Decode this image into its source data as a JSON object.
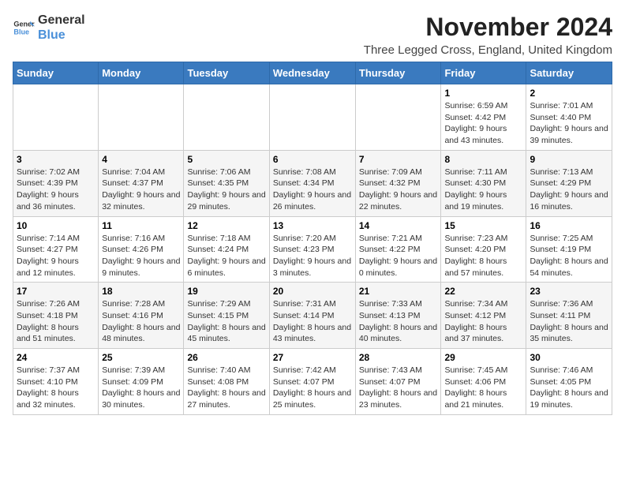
{
  "logo": {
    "line1": "General",
    "line2": "Blue"
  },
  "title": "November 2024",
  "subtitle": "Three Legged Cross, England, United Kingdom",
  "headers": [
    "Sunday",
    "Monday",
    "Tuesday",
    "Wednesday",
    "Thursday",
    "Friday",
    "Saturday"
  ],
  "weeks": [
    [
      {
        "day": "",
        "info": ""
      },
      {
        "day": "",
        "info": ""
      },
      {
        "day": "",
        "info": ""
      },
      {
        "day": "",
        "info": ""
      },
      {
        "day": "",
        "info": ""
      },
      {
        "day": "1",
        "info": "Sunrise: 6:59 AM\nSunset: 4:42 PM\nDaylight: 9 hours and 43 minutes."
      },
      {
        "day": "2",
        "info": "Sunrise: 7:01 AM\nSunset: 4:40 PM\nDaylight: 9 hours and 39 minutes."
      }
    ],
    [
      {
        "day": "3",
        "info": "Sunrise: 7:02 AM\nSunset: 4:39 PM\nDaylight: 9 hours and 36 minutes."
      },
      {
        "day": "4",
        "info": "Sunrise: 7:04 AM\nSunset: 4:37 PM\nDaylight: 9 hours and 32 minutes."
      },
      {
        "day": "5",
        "info": "Sunrise: 7:06 AM\nSunset: 4:35 PM\nDaylight: 9 hours and 29 minutes."
      },
      {
        "day": "6",
        "info": "Sunrise: 7:08 AM\nSunset: 4:34 PM\nDaylight: 9 hours and 26 minutes."
      },
      {
        "day": "7",
        "info": "Sunrise: 7:09 AM\nSunset: 4:32 PM\nDaylight: 9 hours and 22 minutes."
      },
      {
        "day": "8",
        "info": "Sunrise: 7:11 AM\nSunset: 4:30 PM\nDaylight: 9 hours and 19 minutes."
      },
      {
        "day": "9",
        "info": "Sunrise: 7:13 AM\nSunset: 4:29 PM\nDaylight: 9 hours and 16 minutes."
      }
    ],
    [
      {
        "day": "10",
        "info": "Sunrise: 7:14 AM\nSunset: 4:27 PM\nDaylight: 9 hours and 12 minutes."
      },
      {
        "day": "11",
        "info": "Sunrise: 7:16 AM\nSunset: 4:26 PM\nDaylight: 9 hours and 9 minutes."
      },
      {
        "day": "12",
        "info": "Sunrise: 7:18 AM\nSunset: 4:24 PM\nDaylight: 9 hours and 6 minutes."
      },
      {
        "day": "13",
        "info": "Sunrise: 7:20 AM\nSunset: 4:23 PM\nDaylight: 9 hours and 3 minutes."
      },
      {
        "day": "14",
        "info": "Sunrise: 7:21 AM\nSunset: 4:22 PM\nDaylight: 9 hours and 0 minutes."
      },
      {
        "day": "15",
        "info": "Sunrise: 7:23 AM\nSunset: 4:20 PM\nDaylight: 8 hours and 57 minutes."
      },
      {
        "day": "16",
        "info": "Sunrise: 7:25 AM\nSunset: 4:19 PM\nDaylight: 8 hours and 54 minutes."
      }
    ],
    [
      {
        "day": "17",
        "info": "Sunrise: 7:26 AM\nSunset: 4:18 PM\nDaylight: 8 hours and 51 minutes."
      },
      {
        "day": "18",
        "info": "Sunrise: 7:28 AM\nSunset: 4:16 PM\nDaylight: 8 hours and 48 minutes."
      },
      {
        "day": "19",
        "info": "Sunrise: 7:29 AM\nSunset: 4:15 PM\nDaylight: 8 hours and 45 minutes."
      },
      {
        "day": "20",
        "info": "Sunrise: 7:31 AM\nSunset: 4:14 PM\nDaylight: 8 hours and 43 minutes."
      },
      {
        "day": "21",
        "info": "Sunrise: 7:33 AM\nSunset: 4:13 PM\nDaylight: 8 hours and 40 minutes."
      },
      {
        "day": "22",
        "info": "Sunrise: 7:34 AM\nSunset: 4:12 PM\nDaylight: 8 hours and 37 minutes."
      },
      {
        "day": "23",
        "info": "Sunrise: 7:36 AM\nSunset: 4:11 PM\nDaylight: 8 hours and 35 minutes."
      }
    ],
    [
      {
        "day": "24",
        "info": "Sunrise: 7:37 AM\nSunset: 4:10 PM\nDaylight: 8 hours and 32 minutes."
      },
      {
        "day": "25",
        "info": "Sunrise: 7:39 AM\nSunset: 4:09 PM\nDaylight: 8 hours and 30 minutes."
      },
      {
        "day": "26",
        "info": "Sunrise: 7:40 AM\nSunset: 4:08 PM\nDaylight: 8 hours and 27 minutes."
      },
      {
        "day": "27",
        "info": "Sunrise: 7:42 AM\nSunset: 4:07 PM\nDaylight: 8 hours and 25 minutes."
      },
      {
        "day": "28",
        "info": "Sunrise: 7:43 AM\nSunset: 4:07 PM\nDaylight: 8 hours and 23 minutes."
      },
      {
        "day": "29",
        "info": "Sunrise: 7:45 AM\nSunset: 4:06 PM\nDaylight: 8 hours and 21 minutes."
      },
      {
        "day": "30",
        "info": "Sunrise: 7:46 AM\nSunset: 4:05 PM\nDaylight: 8 hours and 19 minutes."
      }
    ]
  ]
}
